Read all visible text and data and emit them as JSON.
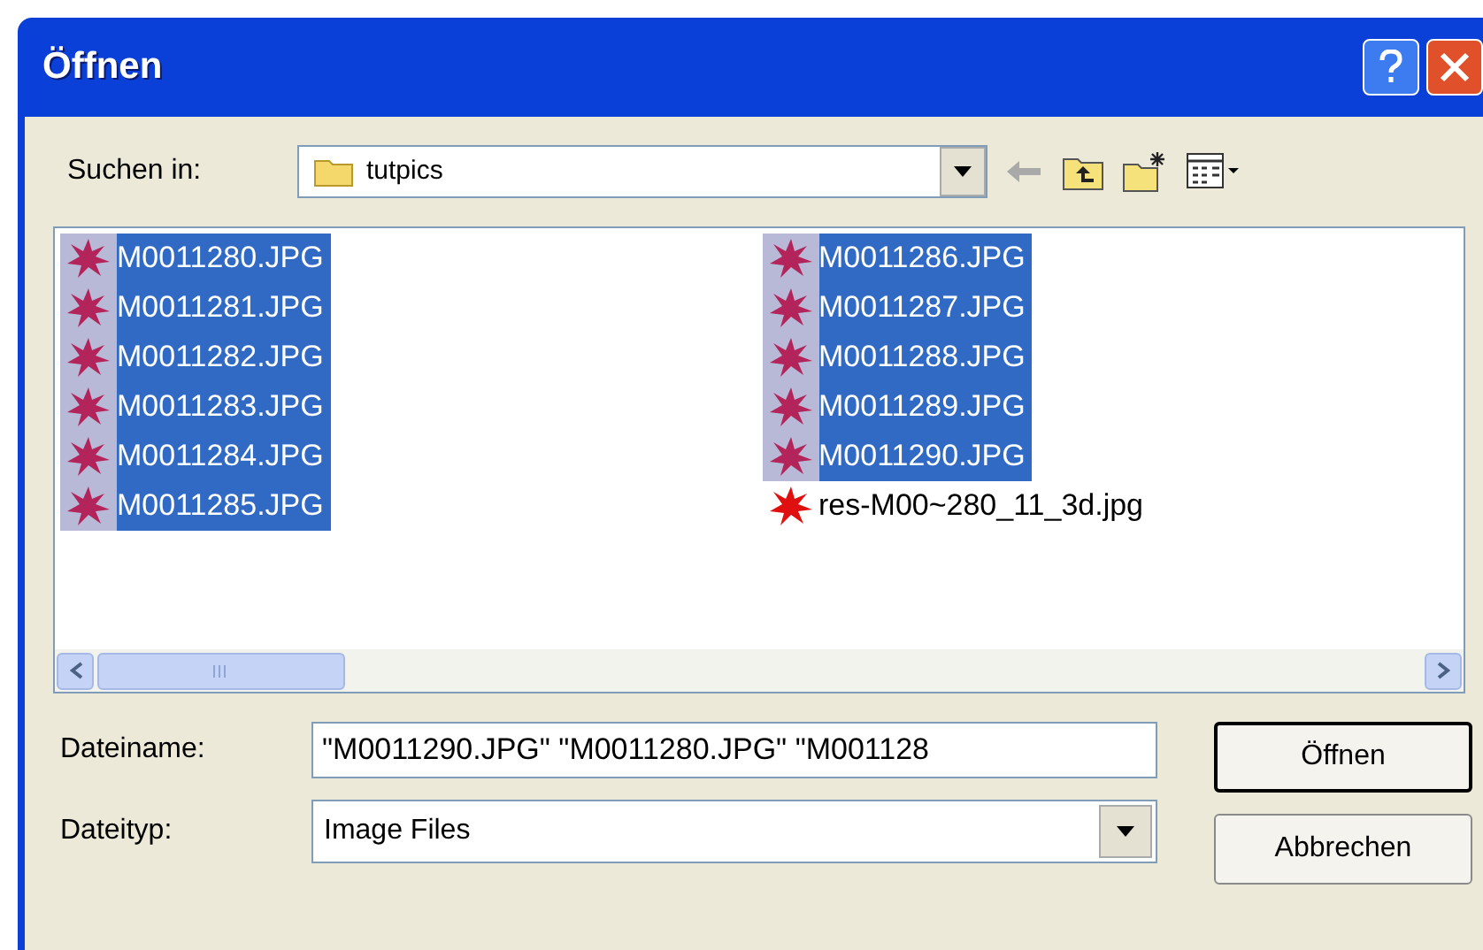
{
  "window": {
    "title": "Öffnen"
  },
  "look_in": {
    "label": "Suchen in:",
    "folder": "tutpics"
  },
  "files": [
    {
      "name": "M0011280.JPG",
      "kind": "thumbnail",
      "selected": true
    },
    {
      "name": "M0011281.JPG",
      "kind": "thumbnail",
      "selected": true
    },
    {
      "name": "M0011282.JPG",
      "kind": "thumbnail",
      "selected": true
    },
    {
      "name": "M0011283.JPG",
      "kind": "thumbnail",
      "selected": true
    },
    {
      "name": "M0011284.JPG",
      "kind": "thumbnail",
      "selected": true
    },
    {
      "name": "M0011285.JPG",
      "kind": "thumbnail",
      "selected": true
    },
    {
      "name": "M0011286.JPG",
      "kind": "thumbnail",
      "selected": true
    },
    {
      "name": "M0011287.JPG",
      "kind": "thumbnail",
      "selected": true
    },
    {
      "name": "M0011288.JPG",
      "kind": "thumbnail",
      "selected": true
    },
    {
      "name": "M0011289.JPG",
      "kind": "thumbnail",
      "selected": true
    },
    {
      "name": "M0011290.JPG",
      "kind": "thumbnail",
      "selected": true
    },
    {
      "name": "res-M00~280_11_3d.jpg",
      "kind": "icon",
      "selected": false
    }
  ],
  "file_name": {
    "label": "Dateiname:",
    "value": "\"M0011290.JPG\" \"M0011280.JPG\" \"M001128"
  },
  "file_type": {
    "label": "Dateityp:",
    "value": "Image Files"
  },
  "buttons": [
    "Öffnen",
    "Abbrechen"
  ]
}
